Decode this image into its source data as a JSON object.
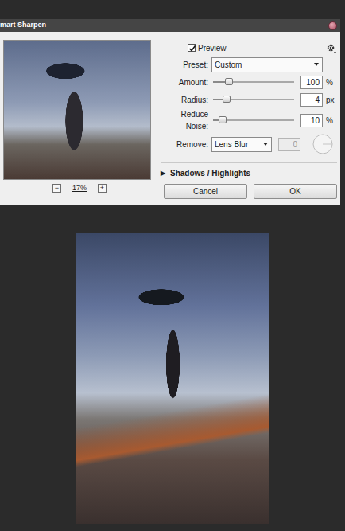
{
  "window": {
    "title": "mart Sharpen"
  },
  "preview": {
    "label": "Preview",
    "checked": true
  },
  "preset": {
    "label": "Preset:",
    "value": "Custom"
  },
  "sliders": [
    {
      "label": "Amount:",
      "value": "100",
      "unit": "%",
      "level": 0.2
    },
    {
      "label": "Radius:",
      "value": "4",
      "unit": "px",
      "level": 0.17
    },
    {
      "label": "Reduce Noise:",
      "value": "10",
      "unit": "%",
      "level": 0.12
    }
  ],
  "remove": {
    "label": "Remove:",
    "value": "Lens Blur",
    "angle": "0",
    "angle_disabled": true
  },
  "section": {
    "arrow": "▶",
    "label": "Shadows / Highlights",
    "expanded": false
  },
  "zoom": {
    "minus": "−",
    "value": "17%",
    "plus": "+"
  },
  "buttons": [
    {
      "label": "Cancel"
    },
    {
      "label": "OK"
    }
  ]
}
